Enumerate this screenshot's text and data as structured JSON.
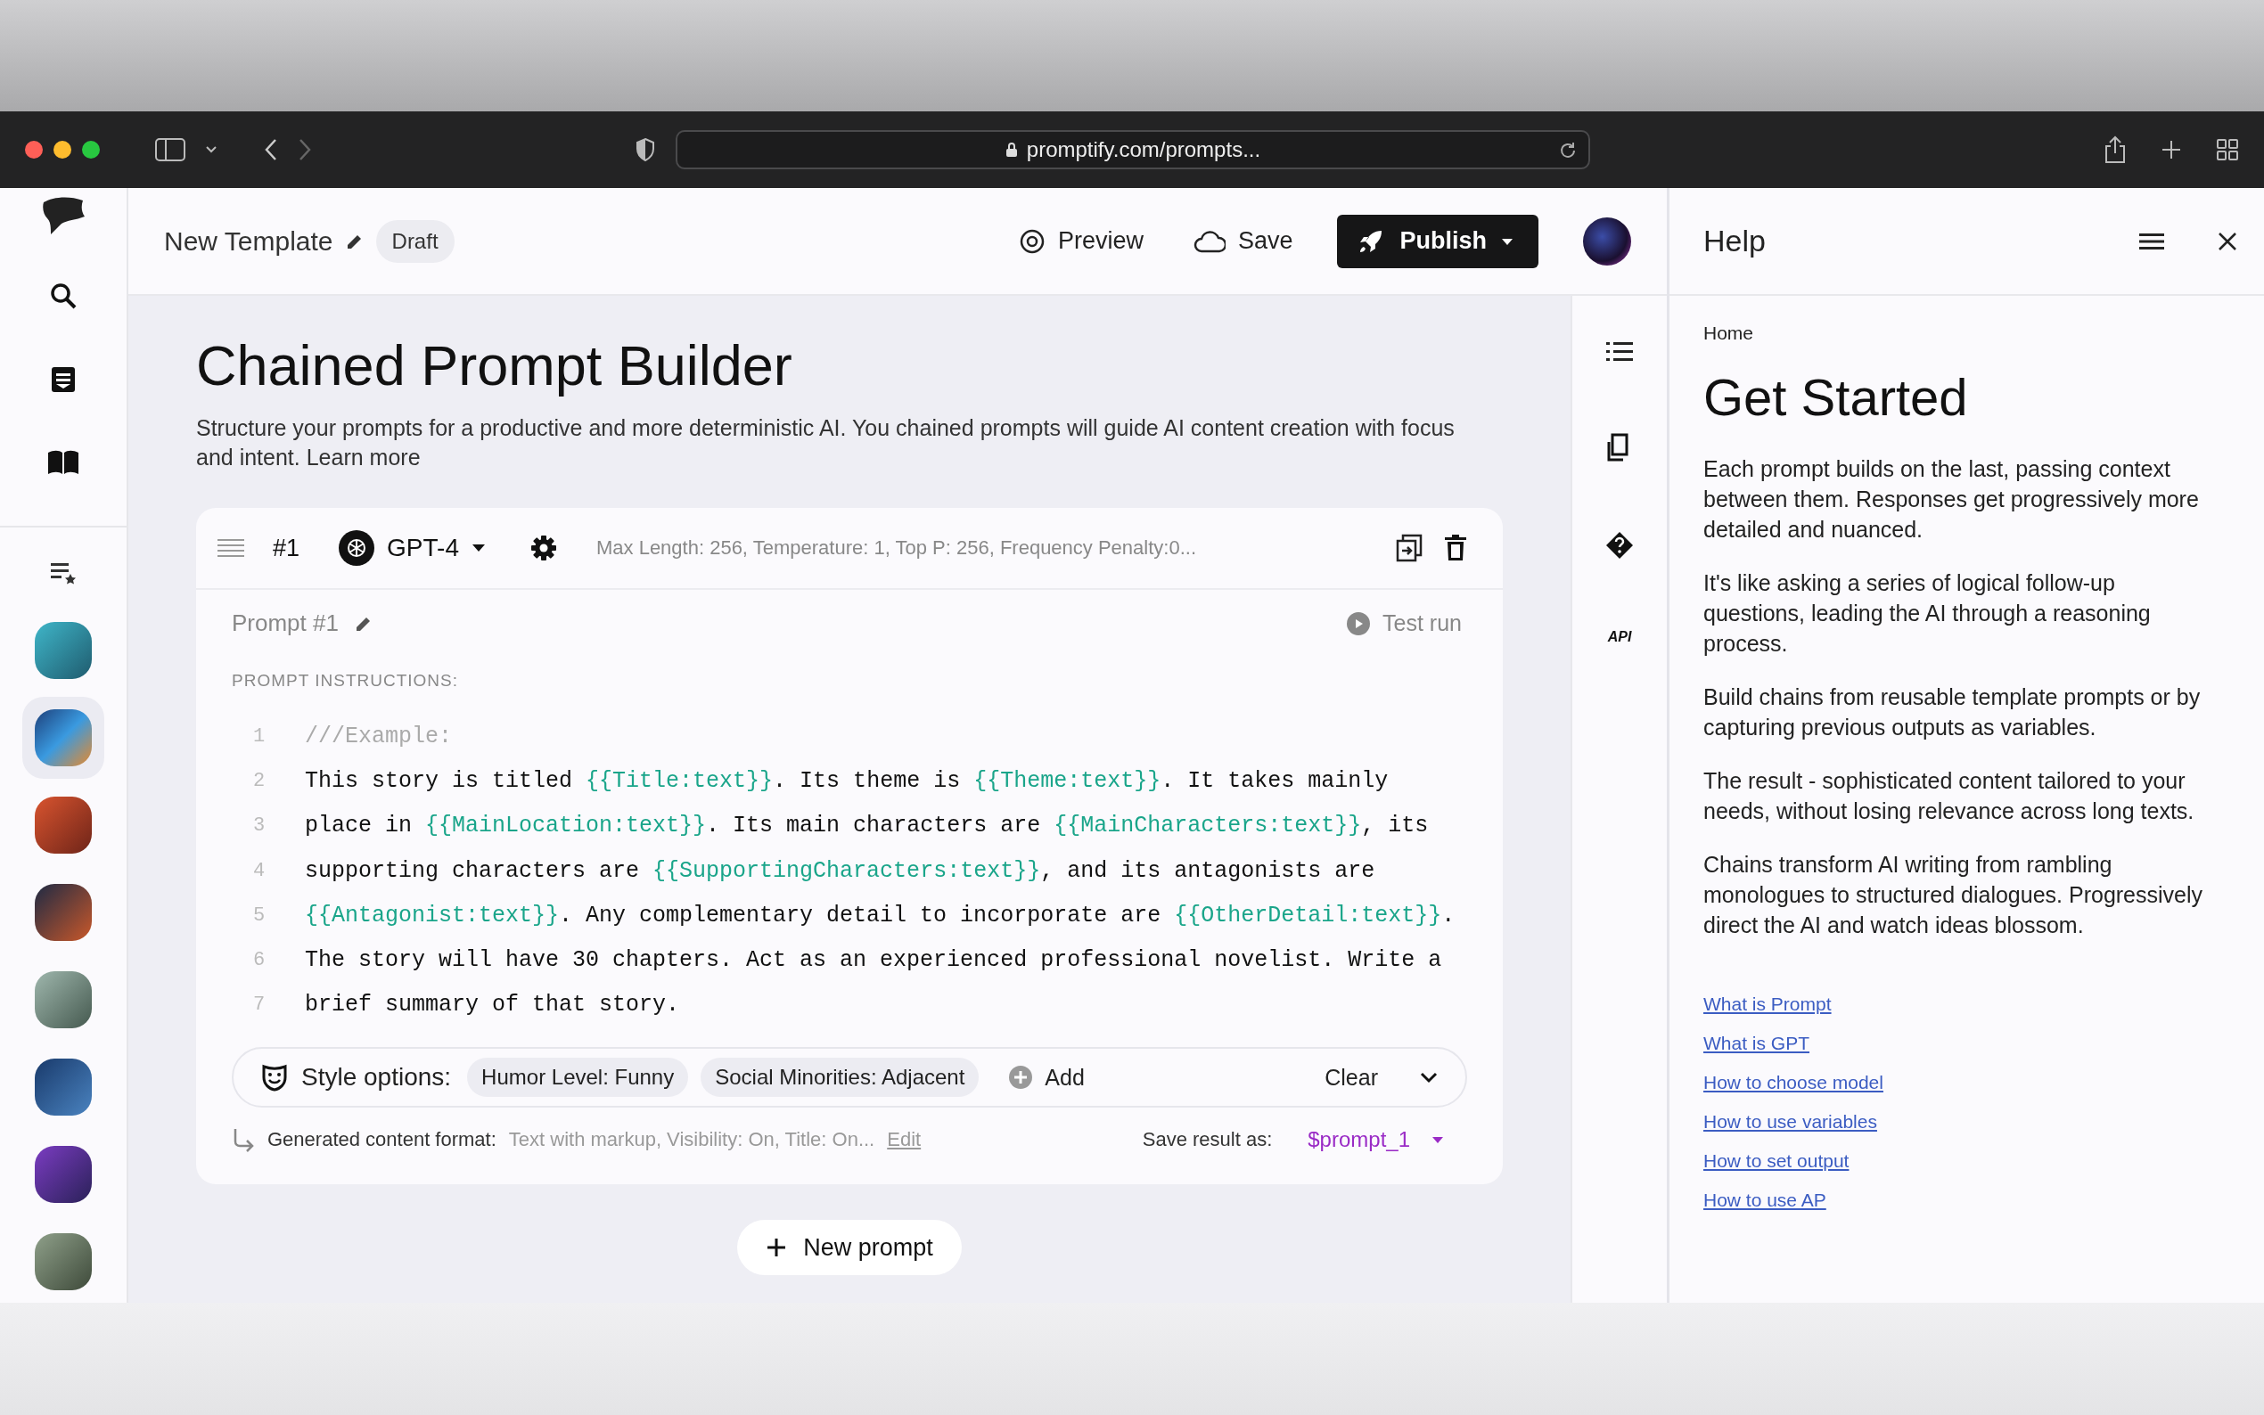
{
  "browser": {
    "url": "promptify.com/prompts..."
  },
  "header": {
    "title": "New Template",
    "status": "Draft",
    "actions": [
      {
        "kind": "preview",
        "label": "Preview"
      },
      {
        "kind": "save",
        "label": "Save"
      }
    ],
    "publish": "Publish"
  },
  "sidebar": {
    "avatars": [
      {
        "selected": false
      },
      {
        "selected": true
      },
      {
        "selected": false
      },
      {
        "selected": false
      },
      {
        "selected": false
      },
      {
        "selected": false
      },
      {
        "selected": false
      },
      {
        "selected": false
      }
    ]
  },
  "page": {
    "title": "Chained Prompt Builder",
    "description": "Structure your prompts for a productive and more deterministic AI. You chained prompts will guide AI content creation with focus and intent.",
    "learn_more": "Learn more"
  },
  "prompt_card": {
    "number": "#1",
    "model": "GPT-4",
    "params": "Max Length: 256, Temperature: 1, Top P: 256, Frequency Penalty:0...",
    "name": "Prompt #1",
    "test_run": "Test run",
    "instructions_label": "PROMPT INSTRUCTIONS:",
    "lines": [
      {
        "number": "1",
        "segments": [
          {
            "kind": "comment",
            "text": "///Example:"
          }
        ]
      },
      {
        "number": "2",
        "segments": [
          {
            "kind": "text",
            "text": "This story is titled "
          },
          {
            "kind": "var",
            "text": "{{Title:text}}"
          },
          {
            "kind": "text",
            "text": ". Its theme is "
          },
          {
            "kind": "var",
            "text": "{{Theme:text}}"
          },
          {
            "kind": "text",
            "text": ". It takes mainly"
          }
        ]
      },
      {
        "number": "3",
        "segments": [
          {
            "kind": "text",
            "text": "place in "
          },
          {
            "kind": "var",
            "text": "{{MainLocation:text}}"
          },
          {
            "kind": "text",
            "text": ". Its main characters are "
          },
          {
            "kind": "var",
            "text": "{{MainCharacters:text}}"
          },
          {
            "kind": "text",
            "text": ", its"
          }
        ]
      },
      {
        "number": "4",
        "segments": [
          {
            "kind": "text",
            "text": "supporting characters are "
          },
          {
            "kind": "var",
            "text": "{{SupportingCharacters:text}}"
          },
          {
            "kind": "text",
            "text": ", and its antagonists are"
          }
        ]
      },
      {
        "number": "5",
        "segments": [
          {
            "kind": "var",
            "text": "{{Antagonist:text}}"
          },
          {
            "kind": "text",
            "text": ". Any complementary detail to incorporate are "
          },
          {
            "kind": "var",
            "text": "{{OtherDetail:text}}"
          },
          {
            "kind": "text",
            "text": "."
          }
        ]
      },
      {
        "number": "6",
        "segments": [
          {
            "kind": "text",
            "text": "The story will have 30 chapters. Act as an experienced professional novelist. Write a"
          }
        ]
      },
      {
        "number": "7",
        "segments": [
          {
            "kind": "text",
            "text": "brief summary of that story."
          }
        ]
      }
    ],
    "style_options": {
      "label": "Style options:",
      "chips": [
        "Humor Level: Funny",
        "Social Minorities: Adjacent"
      ],
      "add": "Add",
      "clear": "Clear"
    },
    "output": {
      "label": "Generated content format:",
      "value": "Text with markup, Visibility: On, Title: On...",
      "edit": "Edit",
      "save_label": "Save result as:",
      "variable": "$prompt_1"
    }
  },
  "new_prompt": "New prompt",
  "tools": {
    "api": "API"
  },
  "help": {
    "title": "Help",
    "breadcrumb": "Home",
    "heading": "Get Started",
    "paragraphs": [
      "Each prompt builds on the last, passing context between them. Responses get progressively more detailed and nuanced.",
      "It's like asking a series of logical follow-up questions, leading the AI through a reasoning process.",
      "Build chains from reusable template prompts or by capturing previous outputs as variables.",
      "The result - sophisticated content tailored to your needs, without losing relevance across long texts.",
      "Chains transform AI writing from rambling monologues to structured dialogues. Progressively direct the AI and watch ideas blossom."
    ],
    "links": [
      "What is Prompt",
      "What is GPT",
      "How to choose model",
      "How to use variables",
      "How to set output",
      "How to use AP"
    ]
  }
}
